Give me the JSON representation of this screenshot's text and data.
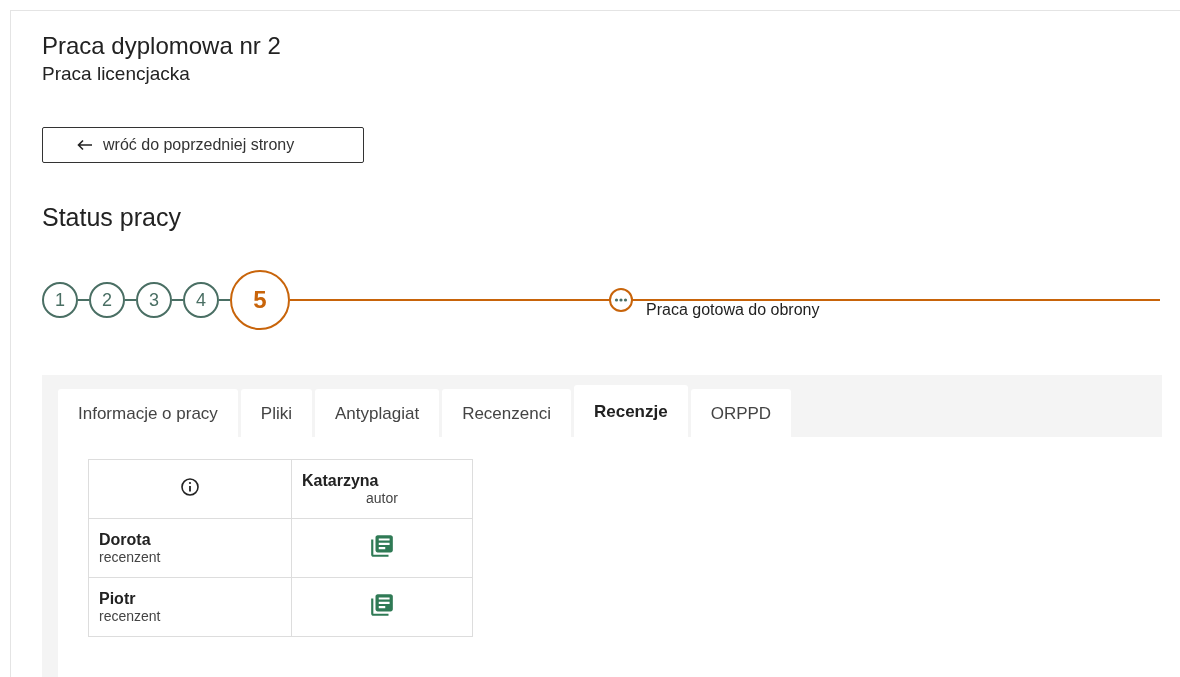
{
  "title": "Praca dyplomowa nr 2",
  "subtitle": "Praca licencjacka",
  "back_button": {
    "label": "wróć do poprzedniej strony"
  },
  "status": {
    "heading": "Status pracy",
    "steps": [
      {
        "label": "1",
        "current": false
      },
      {
        "label": "2",
        "current": false
      },
      {
        "label": "3",
        "current": false
      },
      {
        "label": "4",
        "current": false
      },
      {
        "label": "5",
        "current": true
      }
    ],
    "milestone": {
      "label": "Praca gotowa do obrony"
    }
  },
  "tabs": [
    {
      "label": "Informacje o pracy",
      "selected": false
    },
    {
      "label": "Pliki",
      "selected": false
    },
    {
      "label": "Antyplagiat",
      "selected": false
    },
    {
      "label": "Recenzenci",
      "selected": false
    },
    {
      "label": "Recenzje",
      "selected": true
    },
    {
      "label": "ORPPD",
      "selected": false
    }
  ],
  "table": {
    "columns": [
      {
        "name": "Katarzyna",
        "role": "autor"
      }
    ],
    "rows": [
      {
        "name": "Dorota",
        "role": "recenzent"
      },
      {
        "name": "Piotr",
        "role": "recenzent"
      }
    ]
  }
}
